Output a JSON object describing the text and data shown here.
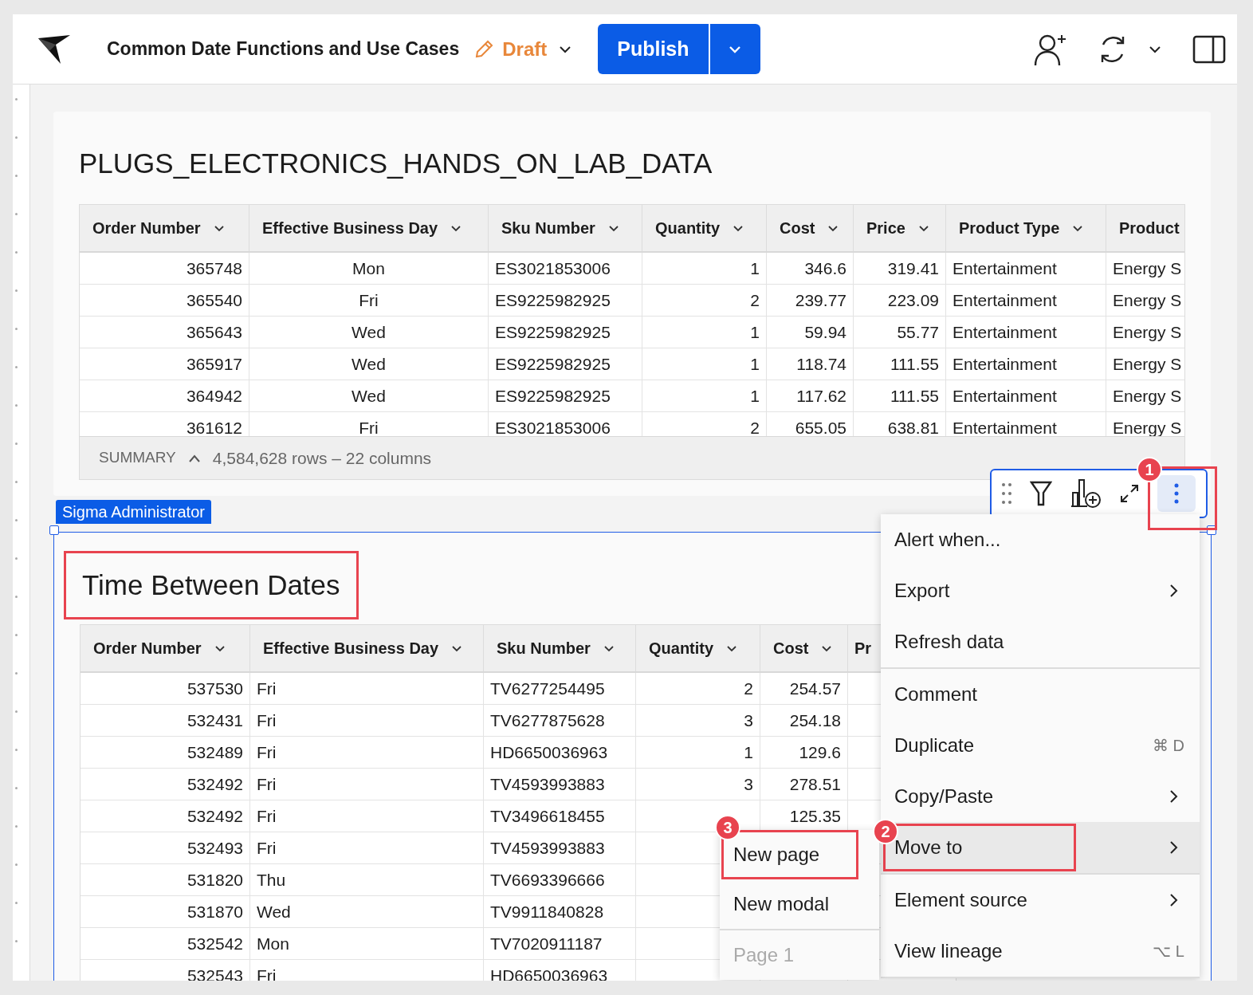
{
  "header": {
    "title": "Common Date Functions and Use Cases",
    "status": "Draft",
    "publish_label": "Publish"
  },
  "tables": [
    {
      "title": "PLUGS_ELECTRONICS_HANDS_ON_LAB_DATA",
      "columns": [
        "Order Number",
        "Effective Business Day",
        "Sku Number",
        "Quantity",
        "Cost",
        "Price",
        "Product Type",
        "Product"
      ],
      "rows": [
        [
          "365748",
          "Mon",
          "ES3021853006",
          "1",
          "346.6",
          "319.41",
          "Entertainment",
          "Energy S"
        ],
        [
          "365540",
          "Fri",
          "ES9225982925",
          "2",
          "239.77",
          "223.09",
          "Entertainment",
          "Energy S"
        ],
        [
          "365643",
          "Wed",
          "ES9225982925",
          "1",
          "59.94",
          "55.77",
          "Entertainment",
          "Energy S"
        ],
        [
          "365917",
          "Wed",
          "ES9225982925",
          "1",
          "118.74",
          "111.55",
          "Entertainment",
          "Energy S"
        ],
        [
          "364942",
          "Wed",
          "ES9225982925",
          "1",
          "117.62",
          "111.55",
          "Entertainment",
          "Energy S"
        ],
        [
          "361612",
          "Fri",
          "ES3021853006",
          "2",
          "655.05",
          "638.81",
          "Entertainment",
          "Energy S"
        ]
      ],
      "summary": {
        "label": "SUMMARY",
        "text": "4,584,628 rows – 22 columns"
      }
    },
    {
      "title": "Time Between Dates",
      "columns": [
        "Order Number",
        "Effective Business Day",
        "Sku Number",
        "Quantity",
        "Cost",
        "Pr"
      ],
      "rows": [
        [
          "537530",
          "Fri",
          "TV6277254495",
          "2",
          "254.57",
          null
        ],
        [
          "532431",
          "Fri",
          "TV6277875628",
          "3",
          "254.18",
          null
        ],
        [
          "532489",
          "Fri",
          "HD6650036963",
          "1",
          "129.6",
          null
        ],
        [
          "532492",
          "Fri",
          "TV4593993883",
          "3",
          "278.51",
          null
        ],
        [
          "532492",
          "Fri",
          "TV3496618455",
          null,
          "125.35",
          null
        ],
        [
          "532493",
          "Fri",
          "TV4593993883",
          null,
          null,
          null
        ],
        [
          "531820",
          "Thu",
          "TV6693396666",
          null,
          null,
          null
        ],
        [
          "531870",
          "Wed",
          "TV9911840828",
          null,
          null,
          null
        ],
        [
          "532542",
          "Mon",
          "TV7020911187",
          null,
          null,
          null
        ],
        [
          "532543",
          "Fri",
          "HD6650036963",
          null,
          null,
          null
        ]
      ]
    }
  ],
  "element_label": "Sigma Administrator",
  "menu": [
    {
      "label": "Alert when...",
      "submenu": false,
      "selected": false,
      "divider_after": false
    },
    {
      "label": "Export",
      "submenu": true,
      "selected": false,
      "divider_after": false
    },
    {
      "label": "Refresh data",
      "submenu": false,
      "selected": false,
      "divider_after": true
    },
    {
      "label": "Comment",
      "submenu": false,
      "selected": false,
      "divider_after": false
    },
    {
      "label": "Duplicate",
      "shortcut": "⌘ D",
      "submenu": false,
      "selected": false,
      "divider_after": false
    },
    {
      "label": "Copy/Paste",
      "submenu": true,
      "selected": false,
      "divider_after": false
    },
    {
      "label": "Move to",
      "submenu": true,
      "selected": true,
      "divider_after": true,
      "step": "2"
    },
    {
      "label": "Element source",
      "submenu": true,
      "selected": false,
      "divider_after": false
    },
    {
      "label": "View lineage",
      "shortcut": "⌥ L",
      "submenu": false,
      "selected": false,
      "divider_after": true
    }
  ],
  "submenu": [
    {
      "label": "New page",
      "disabled": false,
      "divider_after": false,
      "step": "3"
    },
    {
      "label": "New modal",
      "disabled": false,
      "divider_after": true
    },
    {
      "label": "Page 1",
      "disabled": true,
      "divider_after": false
    }
  ],
  "toolbar": {
    "step": "1"
  }
}
